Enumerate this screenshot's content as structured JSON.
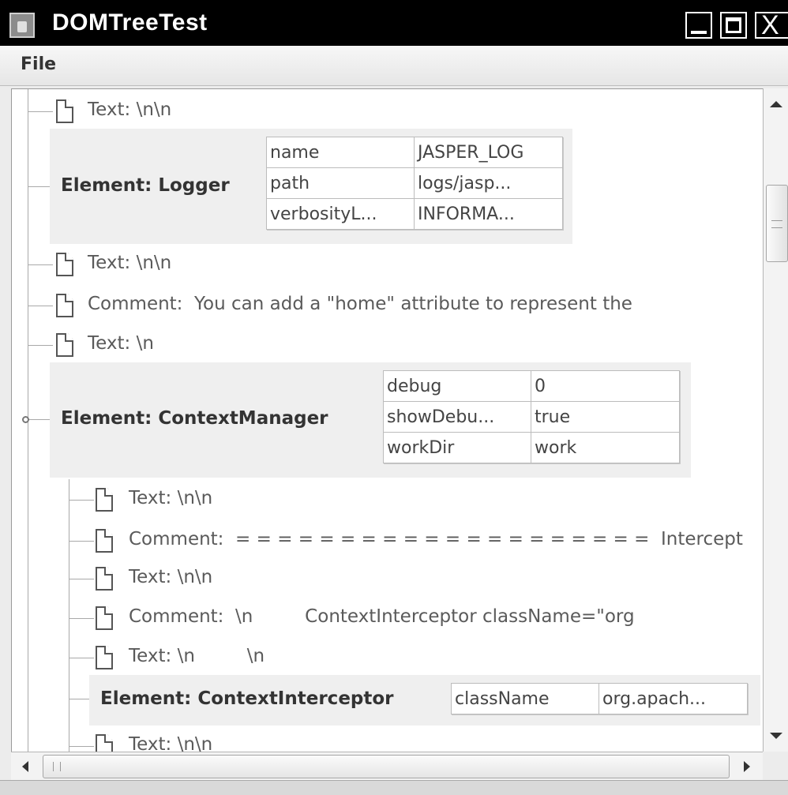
{
  "window": {
    "title": "DOMTreeTest"
  },
  "menubar": {
    "file_label": "File"
  },
  "tree": {
    "nodes": [
      {
        "label": "Text: \\n\\n"
      },
      {
        "element_label": "Element: Logger",
        "attributes": [
          {
            "name": "name",
            "value": "JASPER_LOG"
          },
          {
            "name": "path",
            "value": "logs/jasp..."
          },
          {
            "name": "verbosityL...",
            "value": "INFORMA..."
          }
        ]
      },
      {
        "label": "Text: \\n\\n"
      },
      {
        "label": "Comment:  You can add a \"home\" attribute to represent the"
      },
      {
        "label": "Text: \\n"
      },
      {
        "element_label": "Element: ContextManager",
        "attributes": [
          {
            "name": "debug",
            "value": "0"
          },
          {
            "name": "showDebu...",
            "value": "true"
          },
          {
            "name": "workDir",
            "value": "work"
          }
        ]
      },
      {
        "label": "Text: \\n\\n"
      },
      {
        "label": "Comment:  = = = = = = = = = = = = = = = = = = = =  Intercept"
      },
      {
        "label": "Text: \\n\\n"
      },
      {
        "label": "Comment:  \\n         ContextInterceptor className=\"org"
      },
      {
        "label": "Text: \\n         \\n"
      },
      {
        "element_label": "Element: ContextInterceptor",
        "attributes": [
          {
            "name": "className",
            "value": "org.apach..."
          }
        ]
      },
      {
        "label": "Text: \\n\\n"
      }
    ]
  },
  "icons": {
    "app": "java-cup-icon",
    "minimize": "minimize-icon",
    "maximize": "maximize-icon",
    "close": "close-icon",
    "node": "document-icon",
    "close_glyph": "X"
  },
  "colors": {
    "titlebar": "#000000",
    "title_text": "#ffffff",
    "element_background": "#efefef",
    "tree_background": "#ffffff"
  }
}
